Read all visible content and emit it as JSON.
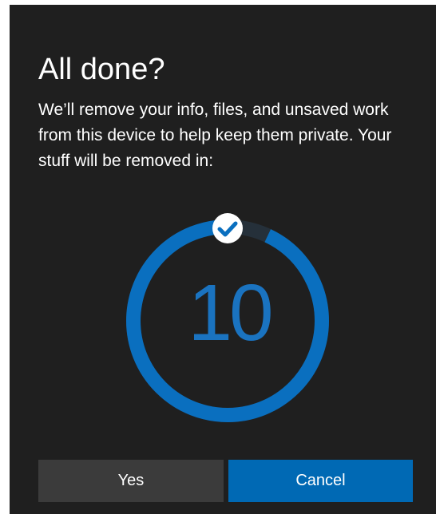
{
  "dialog": {
    "title": "All done?",
    "message": "We’ll remove your info, files, and unsaved work from this device to help keep them private. Your stuff will be removed in:"
  },
  "countdown": {
    "value": "10",
    "progress_fraction": 0.93,
    "ring_color": "#0a6fbf",
    "track_color": "#25303a",
    "check_icon": "checkmark-icon"
  },
  "buttons": {
    "yes_label": "Yes",
    "cancel_label": "Cancel"
  },
  "colors": {
    "background": "#1f1f1f",
    "accent": "#0069b4",
    "secondary_button": "#3b3b3b"
  }
}
